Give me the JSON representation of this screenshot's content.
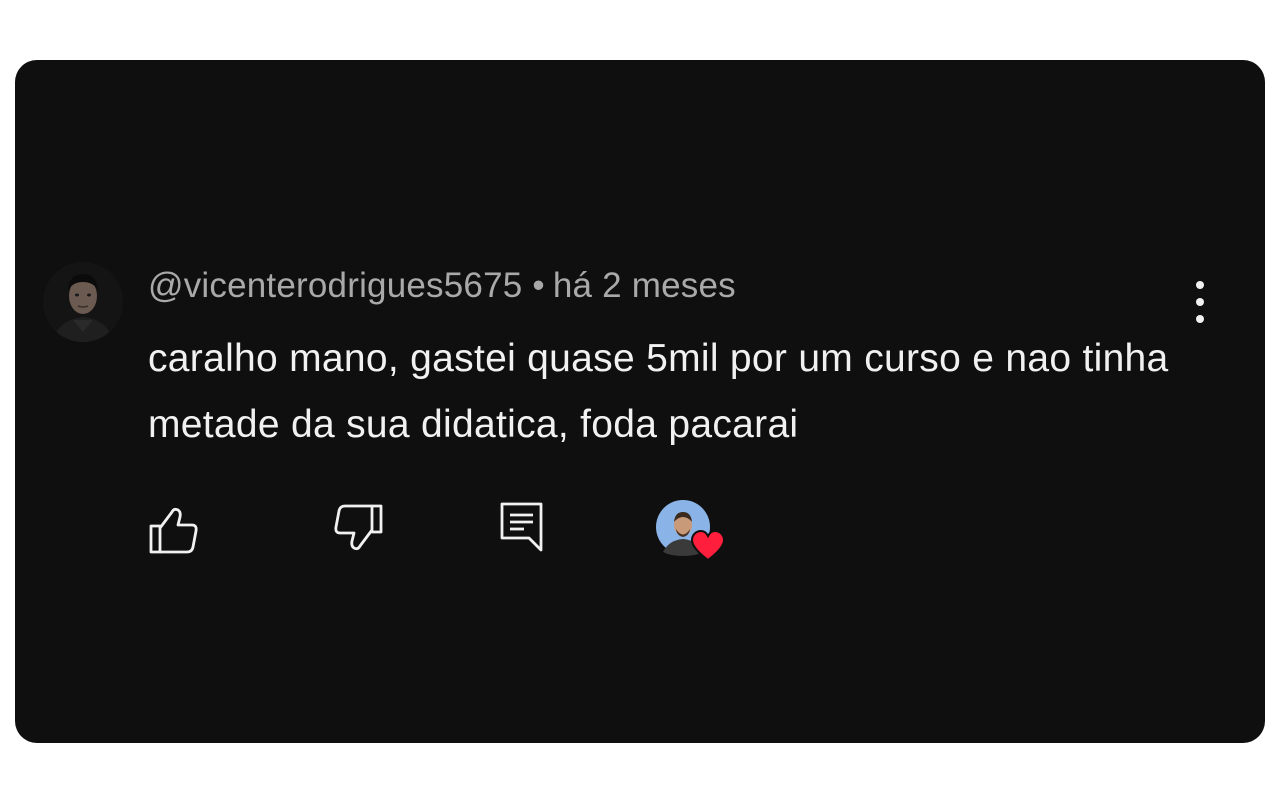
{
  "comment": {
    "author": "@vicenterodrigues5675",
    "separator": "•",
    "time": "há 2 meses",
    "text": "caralho mano, gastei quase 5mil por um curso e nao tinha metade da sua didatica, foda pacarai"
  },
  "icons": {
    "like": "thumbs-up-icon",
    "dislike": "thumbs-down-icon",
    "reply": "comment-reply-icon",
    "menu": "more-vertical-icon",
    "heart": "heart-icon"
  },
  "colors": {
    "card_background": "#0f0f0f",
    "meta_text": "#a9a9a9",
    "comment_text": "#f1f1f1",
    "heart": "#ff1f3d",
    "creator_avatar_bg": "#8ab4e8"
  }
}
